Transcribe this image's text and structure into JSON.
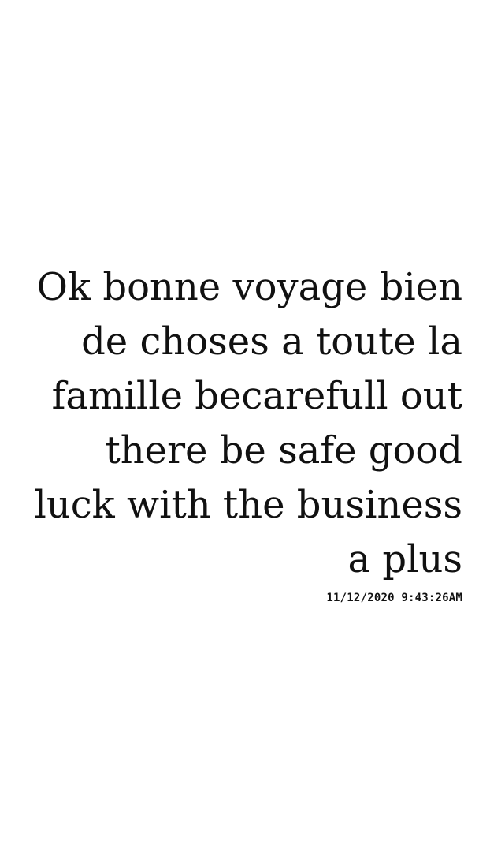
{
  "message": {
    "lines": [
      "Ok bonne voyage bien",
      "de choses a toute la",
      "famille becarefull out",
      "there be safe good",
      "luck with the business",
      "a plus"
    ],
    "timestamp": "11/12/2020 9:43:26AM"
  },
  "colors": {
    "background": "#ffffff",
    "text": "#111111"
  }
}
